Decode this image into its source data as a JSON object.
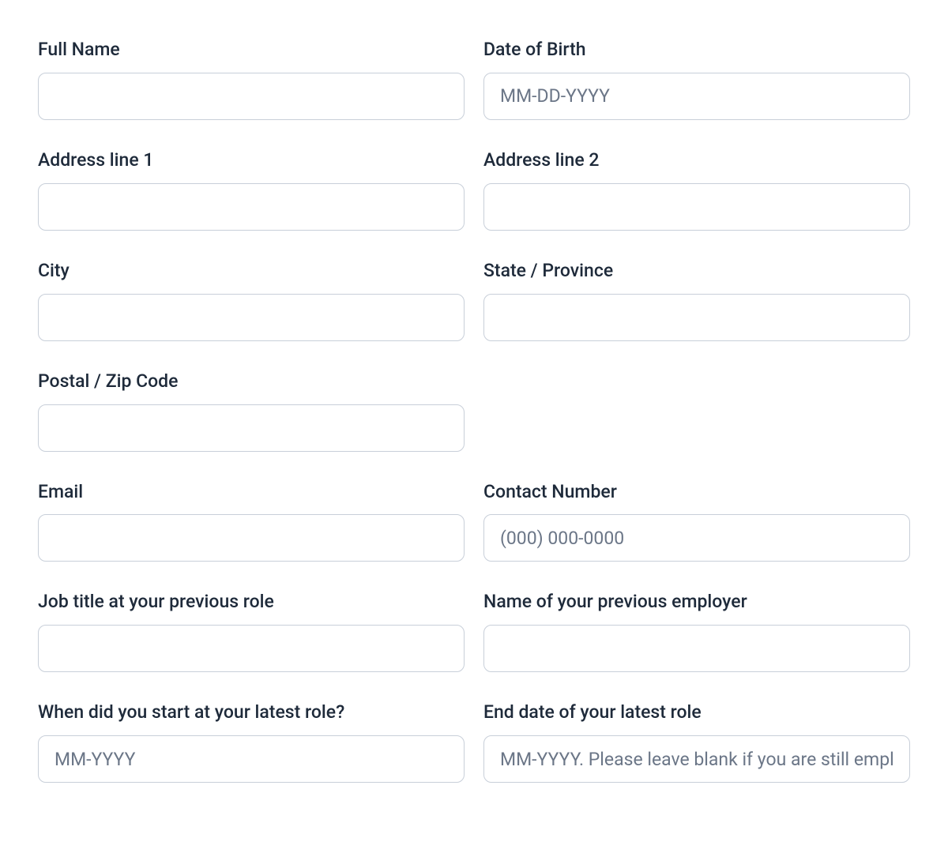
{
  "fields": {
    "full_name": {
      "label": "Full Name",
      "placeholder": "",
      "value": ""
    },
    "dob": {
      "label": "Date of Birth",
      "placeholder": "MM-DD-YYYY",
      "value": ""
    },
    "address1": {
      "label": "Address line 1",
      "placeholder": "",
      "value": ""
    },
    "address2": {
      "label": "Address line 2",
      "placeholder": "",
      "value": ""
    },
    "city": {
      "label": "City",
      "placeholder": "",
      "value": ""
    },
    "state": {
      "label": "State / Province",
      "placeholder": "",
      "value": ""
    },
    "postal": {
      "label": "Postal / Zip Code",
      "placeholder": "",
      "value": ""
    },
    "email": {
      "label": "Email",
      "placeholder": "",
      "value": ""
    },
    "phone": {
      "label": "Contact Number",
      "placeholder": "(000) 000-0000",
      "value": ""
    },
    "prev_job_title": {
      "label": "Job title at your previous role",
      "placeholder": "",
      "value": ""
    },
    "prev_employer": {
      "label": "Name of your previous employer",
      "placeholder": "",
      "value": ""
    },
    "start_date": {
      "label": "When did you start at your latest role?",
      "placeholder": "MM-YYYY",
      "value": ""
    },
    "end_date": {
      "label": "End date of your latest role",
      "placeholder": "MM-YYYY. Please leave blank if you are still employed",
      "value": ""
    }
  }
}
